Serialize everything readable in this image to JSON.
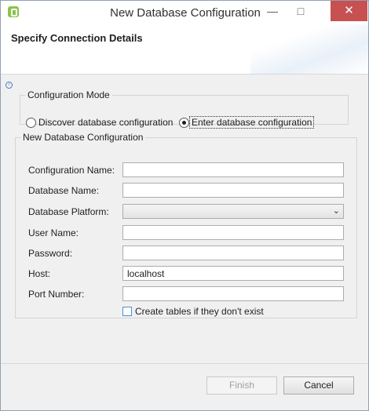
{
  "window": {
    "title": "New Database Configuration",
    "minimize": "—",
    "maximize": "□",
    "close": "✕"
  },
  "header": {
    "title": "Specify Connection Details",
    "info": "i"
  },
  "mode": {
    "legend": "Configuration Mode",
    "options": [
      {
        "label": "Discover database configuration",
        "selected": false
      },
      {
        "label": "Enter database configuration",
        "selected": true
      }
    ]
  },
  "config": {
    "legend": "New Database Configuration",
    "fields": {
      "configuration_name": {
        "label": "Configuration Name:",
        "value": ""
      },
      "database_name": {
        "label": "Database Name:",
        "value": ""
      },
      "database_platform": {
        "label": "Database Platform:",
        "value": ""
      },
      "user_name": {
        "label": "User Name:",
        "value": ""
      },
      "password": {
        "label": "Password:",
        "value": ""
      },
      "host": {
        "label": "Host:",
        "value": "localhost"
      },
      "port_number": {
        "label": "Port Number:",
        "value": ""
      }
    },
    "create_tables": {
      "label": "Create tables if they don't exist",
      "checked": false
    }
  },
  "buttons": {
    "finish": "Finish",
    "cancel": "Cancel"
  },
  "colors": {
    "close_button": "#c75050",
    "app_icon": "#8bc34a",
    "checkbox_border": "#4a8fd6"
  }
}
